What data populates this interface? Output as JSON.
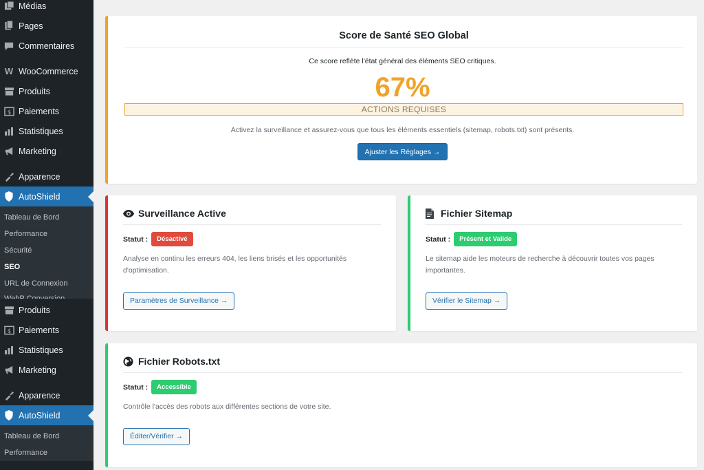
{
  "sidebar": {
    "top_items": [
      {
        "label": "Médias",
        "icon": "media-icon"
      },
      {
        "label": "Pages",
        "icon": "pages-icon"
      },
      {
        "label": "Commentaires",
        "icon": "comments-icon"
      },
      {
        "label": "WooCommerce",
        "icon": "woocommerce-icon"
      },
      {
        "label": "Produits",
        "icon": "products-icon"
      },
      {
        "label": "Paiements",
        "icon": "payments-icon"
      },
      {
        "label": "Statistiques",
        "icon": "stats-icon"
      },
      {
        "label": "Marketing",
        "icon": "marketing-icon"
      },
      {
        "label": "Apparence",
        "icon": "appearance-icon"
      },
      {
        "label": "AutoShield",
        "icon": "shield-icon"
      }
    ],
    "submenu": [
      "Tableau de Bord",
      "Performance",
      "Sécurité",
      "SEO",
      "URL de Connexion",
      "WebP Conversion"
    ],
    "current_sub": "SEO",
    "repeat_items": [
      {
        "label": "Produits",
        "icon": "products-icon"
      },
      {
        "label": "Paiements",
        "icon": "payments-icon"
      },
      {
        "label": "Statistiques",
        "icon": "stats-icon"
      },
      {
        "label": "Marketing",
        "icon": "marketing-icon"
      },
      {
        "label": "Apparence",
        "icon": "appearance-icon"
      },
      {
        "label": "AutoShield",
        "icon": "shield-icon"
      }
    ],
    "repeat_submenu": [
      "Tableau de Bord",
      "Performance"
    ]
  },
  "score": {
    "title": "Score de Santé SEO Global",
    "description": "Ce score reflète l'état général des éléments SEO critiques.",
    "value": "67%",
    "percent": 67,
    "status": "ACTIONS REQUISES",
    "hint": "Activez la surveillance et assurez-vous que tous les éléments essentiels (sitemap, robots.txt) sont présents.",
    "button": "Ajuster les Réglages →",
    "accent": "#f0a32a"
  },
  "surveillance": {
    "title": "Surveillance Active",
    "icon": "eye-icon",
    "status_label": "Statut :",
    "badge": "Désactivé",
    "text": "Analyse en continu les erreurs 404, les liens brisés et les opportunités d'optimisation.",
    "button": "Paramètres de Surveillance →",
    "accent": "#d63638"
  },
  "sitemap": {
    "title": "Fichier Sitemap",
    "icon": "file-icon",
    "status_label": "Statut :",
    "badge": "Présent et Valide",
    "text": "Le sitemap aide les moteurs de recherche à découvrir toutes vos pages importantes.",
    "button": "Vérifier le Sitemap →",
    "accent": "#2ecc71"
  },
  "robots": {
    "title": "Fichier Robots.txt",
    "icon": "globe-icon",
    "status_label": "Statut :",
    "badge": "Accessible",
    "text": "Contrôle l'accès des robots aux différentes sections de votre site.",
    "button": "Éditer/Vérifier →",
    "accent": "#2ecc71"
  }
}
